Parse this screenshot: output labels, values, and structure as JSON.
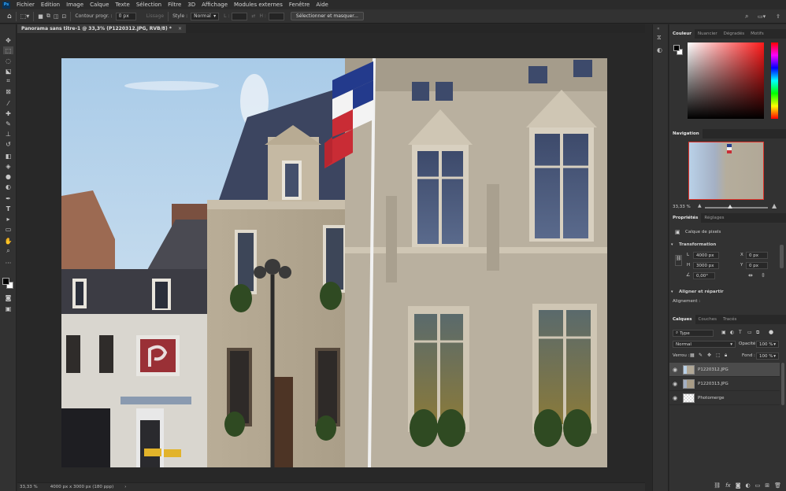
{
  "menu": {
    "logo": "Ps",
    "items": [
      "Fichier",
      "Edition",
      "Image",
      "Calque",
      "Texte",
      "Sélection",
      "Filtre",
      "3D",
      "Affichage",
      "Modules externes",
      "Fenêtre",
      "Aide"
    ]
  },
  "options": {
    "contour_label": "Contour progr. :",
    "contour_value": "0 px",
    "lissage": "Lissage",
    "style_label": "Style :",
    "style_value": "Normal",
    "l_label": "L :",
    "h_label": "H :",
    "select_mask": "Sélectionner et masquer..."
  },
  "document": {
    "tab_title": "Panorama sans titre-1 @ 33,3% (P1220312.JPG, RVB/8) *",
    "close": "×"
  },
  "status": {
    "zoom": "33,33 %",
    "info": "4000 px x 3000 px (180 ppp)",
    "arrow": "›"
  },
  "color_panel": {
    "tabs": [
      "Couleur",
      "Nuancier",
      "Dégradés",
      "Motifs"
    ],
    "hue_color": "#ff1a1a"
  },
  "navigation": {
    "title": "Navigation",
    "zoom": "33,33 %"
  },
  "properties": {
    "tabs": [
      "Propriétés",
      "Réglages"
    ],
    "layer_type": "Calque de pixels",
    "transform_title": "Transformation",
    "w_label": "L",
    "w_value": "4000 px",
    "h_label": "H",
    "h_value": "3000 px",
    "x_label": "X",
    "x_value": "0 px",
    "y_label": "Y",
    "y_value": "0 px",
    "angle_value": "0,00°",
    "align_title": "Aligner et répartir",
    "align_sub": "Alignement :"
  },
  "layers": {
    "tabs": [
      "Calques",
      "Couches",
      "Tracés"
    ],
    "filter": "Type",
    "blend_mode": "Normal",
    "opacity_label": "Opacité :",
    "opacity_value": "100 %",
    "lock_label": "Verrou :",
    "fill_label": "Fond :",
    "fill_value": "100 %",
    "items": [
      {
        "name": "P1220312.JPG",
        "selected": true
      },
      {
        "name": "P1220313.JPG",
        "selected": false
      },
      {
        "name": "Photomerge",
        "selected": false
      }
    ]
  }
}
